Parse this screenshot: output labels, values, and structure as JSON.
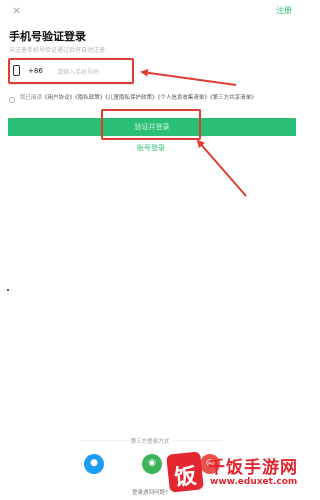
{
  "header": {
    "close_icon": "×",
    "register_label": "注册"
  },
  "login": {
    "title": "手机号验证登录",
    "subtitle": "未注册手机号验证通过后将自动注册",
    "country_code": "+86",
    "phone_placeholder": "请输入手机号码",
    "phone_value": ""
  },
  "agreement": {
    "prefix": "我已阅读",
    "links": [
      "《用户协议》",
      "《隐私政策》",
      "《儿童隐私保护政策》",
      "《个人信息收集清单》",
      "《第三方共享清单》"
    ]
  },
  "actions": {
    "verify_login_label": "验证并登录",
    "password_login_label": "账号登录"
  },
  "third_party": {
    "label": "第三方登录方式",
    "icons": [
      "qq-icon",
      "wechat-icon",
      "weibo-icon"
    ]
  },
  "footer": {
    "help_label": "登录遇到问题?"
  },
  "watermark": {
    "badge_char": "饭",
    "site_name": "千饭手游网",
    "url": "www.eduxet.com"
  },
  "colors": {
    "accent_green": "#2bbf76",
    "annotation_red": "#e03c31",
    "watermark_red": "#e3262f"
  }
}
